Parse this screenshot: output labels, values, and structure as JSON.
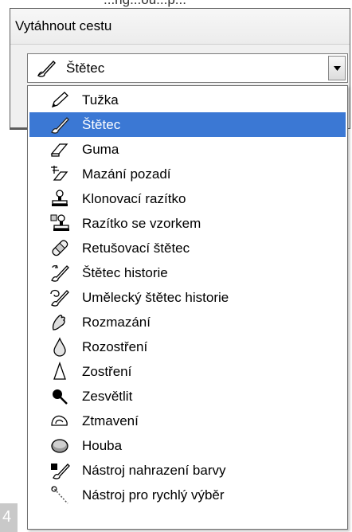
{
  "header_crop": "...ng...ou...p...",
  "panel": {
    "title": "Vytáhnout cestu"
  },
  "combo": {
    "selected_label": "Štětec",
    "selected_icon": "brush-icon"
  },
  "dropdown": {
    "items": [
      {
        "label": "Tužka",
        "icon": "pencil-icon",
        "selected": false
      },
      {
        "label": "Štětec",
        "icon": "brush-icon",
        "selected": true
      },
      {
        "label": "Guma",
        "icon": "eraser-icon",
        "selected": false
      },
      {
        "label": "Mazání pozadí",
        "icon": "background-eraser-icon",
        "selected": false
      },
      {
        "label": "Klonovací razítko",
        "icon": "clone-stamp-icon",
        "selected": false
      },
      {
        "label": "Razítko se vzorkem",
        "icon": "pattern-stamp-icon",
        "selected": false
      },
      {
        "label": "Retušovací štětec",
        "icon": "healing-brush-icon",
        "selected": false
      },
      {
        "label": "Štětec historie",
        "icon": "history-brush-icon",
        "selected": false
      },
      {
        "label": "Umělecký štětec historie",
        "icon": "art-history-brush-icon",
        "selected": false
      },
      {
        "label": "Rozmazání",
        "icon": "smudge-icon",
        "selected": false
      },
      {
        "label": "Rozostření",
        "icon": "blur-icon",
        "selected": false
      },
      {
        "label": "Zostření",
        "icon": "sharpen-icon",
        "selected": false
      },
      {
        "label": "Zesvětlit",
        "icon": "dodge-icon",
        "selected": false
      },
      {
        "label": "Ztmavení",
        "icon": "burn-icon",
        "selected": false
      },
      {
        "label": "Houba",
        "icon": "sponge-icon",
        "selected": false
      },
      {
        "label": "Nástroj nahrazení barvy",
        "icon": "color-replacement-icon",
        "selected": false
      },
      {
        "label": "Nástroj pro rychlý výběr",
        "icon": "quick-selection-icon",
        "selected": false
      }
    ]
  },
  "corner_mark": "4",
  "colors": {
    "selection": "#3b78d4",
    "border": "#6e6e6e"
  }
}
